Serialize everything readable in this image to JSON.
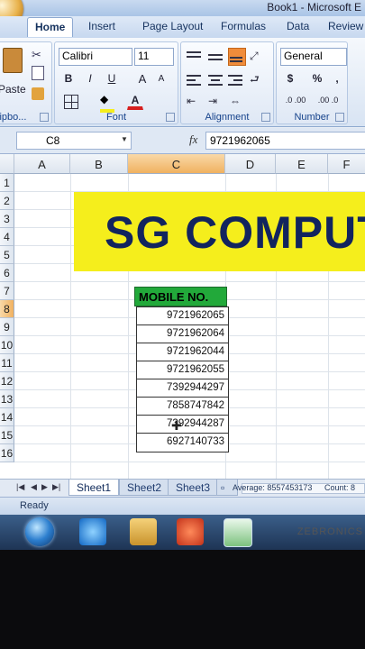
{
  "window": {
    "title": "Book1 - Microsoft E"
  },
  "tabs": [
    {
      "label": "Home",
      "active": true
    },
    {
      "label": "Insert"
    },
    {
      "label": "Page Layout"
    },
    {
      "label": "Formulas"
    },
    {
      "label": "Data"
    },
    {
      "label": "Review"
    }
  ],
  "ribbon": {
    "clipboard": {
      "paste_label": "Paste",
      "group_label": "lipbo..."
    },
    "font": {
      "name": "Calibri",
      "size": "11",
      "bold": "B",
      "italic": "I",
      "underline": "U",
      "grow": "A",
      "shrink": "A",
      "color_letter": "A",
      "group_label": "Font"
    },
    "alignment": {
      "group_label": "Alignment"
    },
    "number": {
      "format": "General",
      "currency": "$",
      "percent": "%",
      "comma": ",",
      "inc_dec": ".0 .00",
      "dec_dec": ".00 .0",
      "group_label": "Number"
    }
  },
  "formula_bar": {
    "cell_ref": "C8",
    "fx": "fx",
    "value": "9721962065"
  },
  "columns": [
    "A",
    "B",
    "C",
    "D",
    "E",
    "F"
  ],
  "selected_column": "C",
  "rows": [
    "1",
    "2",
    "3",
    "4",
    "5",
    "6",
    "7",
    "8",
    "9",
    "10",
    "11",
    "12",
    "13",
    "14",
    "15",
    "16"
  ],
  "selected_row": "8",
  "banner": {
    "text": "SG COMPUT",
    "bg": "#f5ee1c",
    "fg": "#12245e"
  },
  "table": {
    "header": "MOBILE NO.",
    "header_bg": "#22a93a",
    "values": [
      "9721962065",
      "9721962064",
      "9721962044",
      "9721962055",
      "7392944297",
      "7858747842",
      "7392944287",
      "6927140733"
    ]
  },
  "sheet_tabs": [
    {
      "label": "Sheet1",
      "active": true
    },
    {
      "label": "Sheet2"
    },
    {
      "label": "Sheet3"
    }
  ],
  "status": {
    "ready": "Ready",
    "average": "Average: 8557453173",
    "count": "Count: 8"
  },
  "bezel": {
    "brand": "ZEBRONICS"
  }
}
